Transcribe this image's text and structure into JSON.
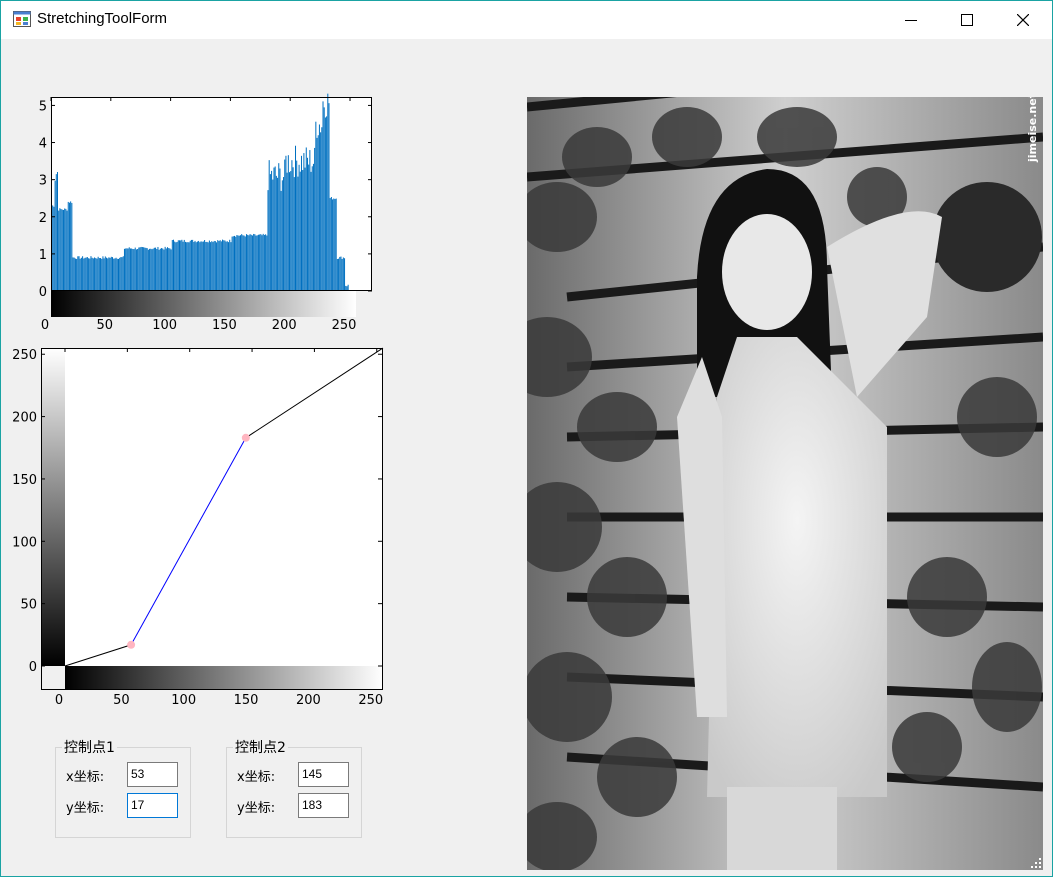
{
  "window": {
    "title": "StretchingToolForm",
    "border_color": "#1aa3a3",
    "buttons": [
      "minimize",
      "maximize",
      "close"
    ]
  },
  "histogram": {
    "y_ticks": [
      "0",
      "1",
      "2",
      "3",
      "4",
      "5"
    ],
    "x_ticks": [
      "0",
      "50",
      "100",
      "150",
      "200",
      "250"
    ],
    "bar_color": "#0070c0",
    "chart_data": {
      "type": "bar",
      "xlim": [
        0,
        255
      ],
      "ylim": [
        0,
        5.2
      ],
      "segments": [
        {
          "x": [
            0,
            2
          ],
          "value": 2.3
        },
        {
          "x": [
            3,
            5
          ],
          "value": 3.2
        },
        {
          "x": [
            6,
            13
          ],
          "value": 2.2
        },
        {
          "x": [
            14,
            17
          ],
          "value": 2.4
        },
        {
          "x": [
            18,
            60
          ],
          "value": 0.9
        },
        {
          "x": [
            61,
            100
          ],
          "value": 1.15
        },
        {
          "x": [
            101,
            150
          ],
          "value": 1.35
        },
        {
          "x": [
            151,
            180
          ],
          "value": 1.5
        },
        {
          "x": [
            181,
            195
          ],
          "value": 3.1
        },
        {
          "x": [
            196,
            220
          ],
          "value": 3.5
        },
        {
          "x": [
            221,
            226
          ],
          "value": 4.5
        },
        {
          "x": [
            227,
            232
          ],
          "value": 5.1
        },
        {
          "x": [
            233,
            238
          ],
          "value": 2.5
        },
        {
          "x": [
            239,
            245
          ],
          "value": 0.9
        },
        {
          "x": [
            246,
            248
          ],
          "value": 0.15
        }
      ]
    }
  },
  "curve": {
    "y_ticks": [
      "0",
      "50",
      "100",
      "150",
      "200",
      "250"
    ],
    "x_ticks": [
      "0",
      "50",
      "100",
      "150",
      "200",
      "250"
    ],
    "line_color": "#000000",
    "middle_color": "#0000ff",
    "point_color": "#ffb6c1",
    "chart_data": {
      "type": "line",
      "xlim": [
        0,
        255
      ],
      "ylim": [
        0,
        255
      ],
      "points": [
        [
          0,
          0
        ],
        [
          53,
          17
        ],
        [
          145,
          183
        ],
        [
          255,
          255
        ]
      ]
    }
  },
  "control_points": [
    {
      "title": "控制点1",
      "x_label": "x坐标:",
      "y_label": "y坐标:",
      "x_value": "53",
      "y_value": "17"
    },
    {
      "title": "控制点2",
      "x_label": "x坐标:",
      "y_label": "y坐标:",
      "x_value": "145",
      "y_value": "183"
    }
  ],
  "photo": {
    "watermark": "jimeise.net"
  }
}
